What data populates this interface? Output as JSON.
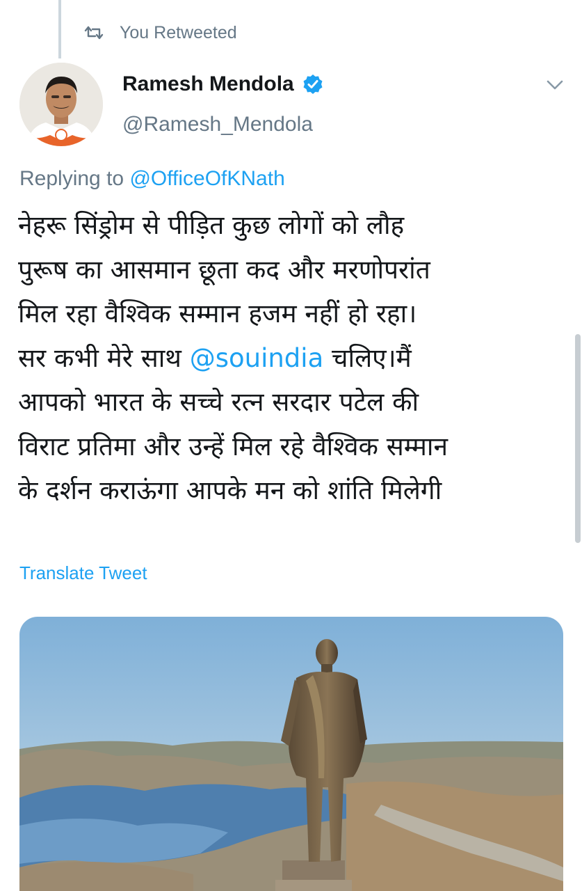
{
  "retweet": {
    "label": "You Retweeted",
    "icon": "retweet-icon"
  },
  "author": {
    "name": "Ramesh Mendola",
    "handle": "@Ramesh_Mendola",
    "verified": true,
    "verified_icon": "verified-badge-icon",
    "avatar_icon": "profile-photo"
  },
  "more_icon": "chevron-down-icon",
  "reply": {
    "prefix": "Replying to ",
    "mention": "@OfficeOfKNath"
  },
  "tweet": {
    "line1": "नेहरू सिंड्रोम से पीड़ित कुछ लोगों को लौह",
    "line2": "पुरूष  का आसमान छूता कद और मरणोपरांत",
    "line3": "मिल रहा वैश्विक सम्मान हजम नहीं हो रहा।",
    "line4_before": "सर कभी मेरे साथ ",
    "line4_mention": "@souindia",
    "line4_after": " चलिए।मैं",
    "line5": "आपको भारत के सच्चे रत्न सरदार पटेल की",
    "line6": "विराट प्रतिमा और उन्हें मिल रहे वैश्विक सम्मान",
    "line7": "के दर्शन कराऊंगा आपके मन को शांति मिलेगी"
  },
  "translate_label": "Translate Tweet",
  "media": {
    "description_icon": "statue-photo"
  },
  "colors": {
    "link": "#1da1f2",
    "secondary_text": "#657786",
    "primary_text": "#14171a",
    "thread_line": "#ccd6dd"
  }
}
